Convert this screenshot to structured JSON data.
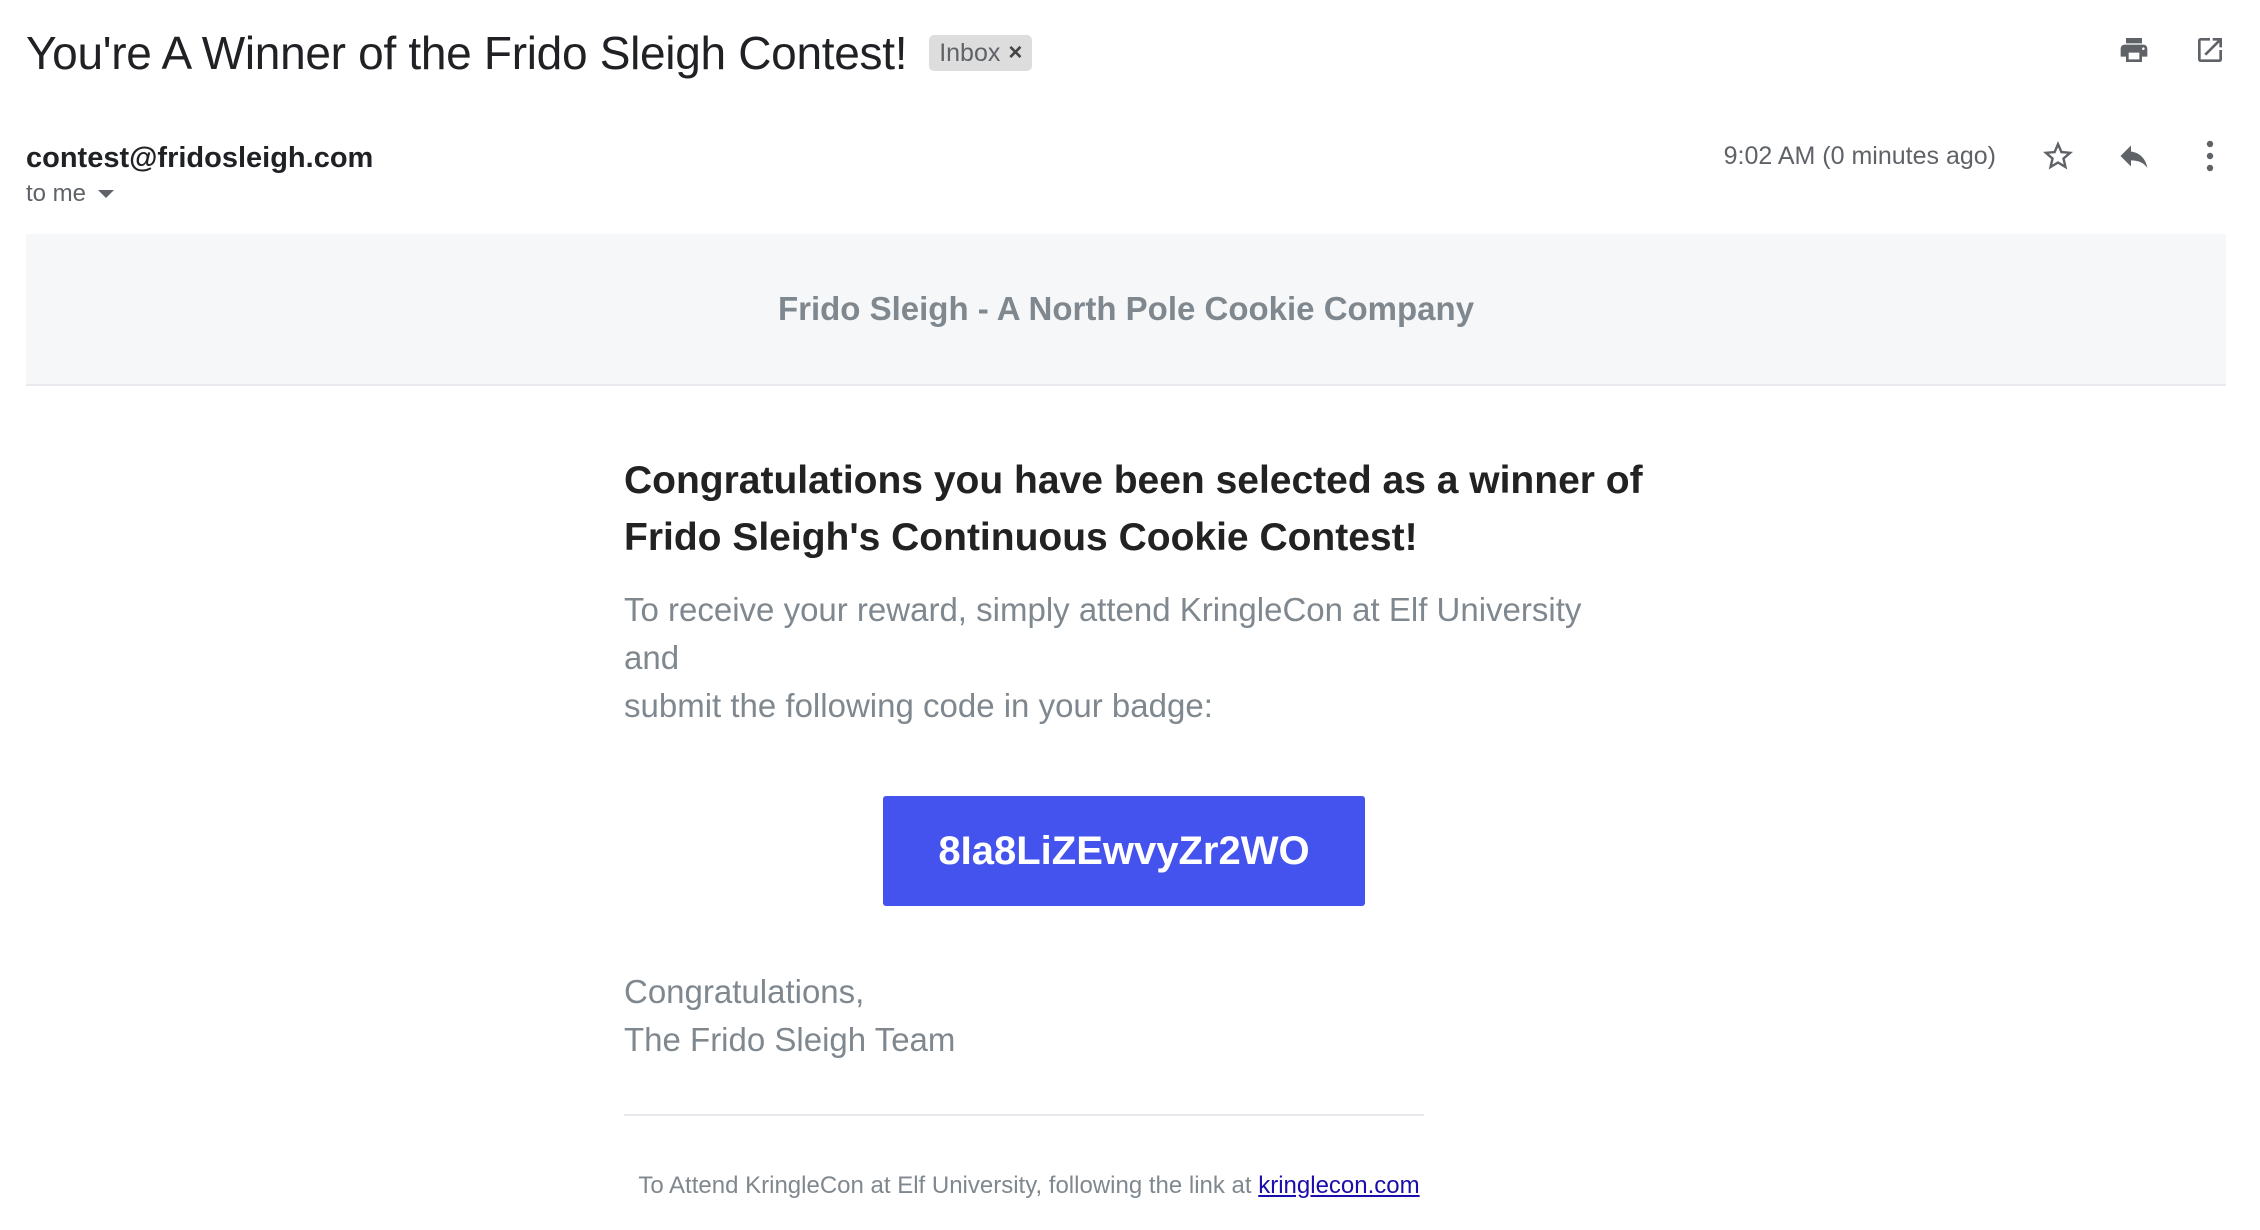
{
  "header": {
    "subject": "You're A Winner of the Frido Sleigh Contest!",
    "label": "Inbox",
    "label_remove": "×"
  },
  "actions": {
    "print_icon": "print-icon",
    "open_new_window_icon": "open-in-new-icon",
    "star_icon": "star-icon",
    "reply_icon": "reply-icon",
    "more_icon": "more-vert-icon"
  },
  "message": {
    "sender_email": "contest@fridosleigh.com",
    "recipient": "to me",
    "timestamp": "9:02 AM (0 minutes ago)"
  },
  "email_body": {
    "banner": "Frido Sleigh - A North Pole Cookie Company",
    "headline_line1": "Congratulations you have been selected as a winner of",
    "headline_line2": "Frido Sleigh's Continuous Cookie Contest!",
    "intro_line1": "To receive your reward, simply attend KringleCon at Elf University and",
    "intro_line2": "submit the following code in your badge:",
    "code": "8Ia8LiZEwvyZr2WO",
    "signoff_line1": "Congratulations,",
    "signoff_line2": "The Frido Sleigh Team",
    "footer_text": "To Attend KringleCon at Elf University, following the link at ",
    "footer_link": "kringlecon.com"
  },
  "colors": {
    "code_button": "#4452ee",
    "banner_bg": "#f6f7f8",
    "muted_text": "#80888f",
    "link": "#1a0dab"
  }
}
